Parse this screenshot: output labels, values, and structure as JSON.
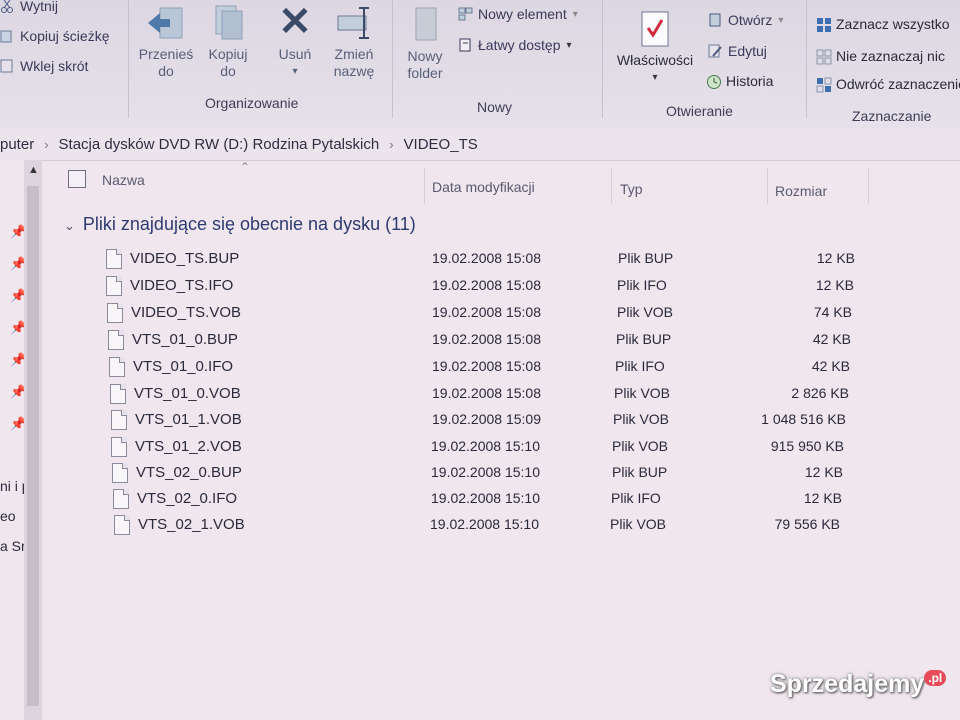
{
  "ribbon": {
    "clipboard": {
      "cut_label": "Wytnij",
      "copy_path_label": "Kopiuj ścieżkę",
      "paste_shortcut_label": "Wklej skrót"
    },
    "organize": {
      "move_label": "Przenieś",
      "move_sub": "do",
      "copy_label": "Kopiuj",
      "copy_sub": "do",
      "delete_label": "Usuń",
      "rename_label": "Zmień",
      "rename_sub": "nazwę",
      "group_label": "Organizowanie"
    },
    "new": {
      "new_folder_label": "Nowy",
      "new_folder_sub": "folder",
      "new_item_label": "Nowy element",
      "easy_access_label": "Łatwy dostęp",
      "group_label": "Nowy"
    },
    "open": {
      "properties_label": "Właściwości",
      "open_label": "Otwórz",
      "edit_label": "Edytuj",
      "history_label": "Historia",
      "group_label": "Otwieranie"
    },
    "select": {
      "select_all_label": "Zaznacz wszystko",
      "select_none_label": "Nie zaznaczaj nic",
      "invert_label": "Odwróć zaznaczenie",
      "group_label": "Zaznaczanie"
    }
  },
  "address": {
    "crumbs": [
      "puter",
      "Stacja dysków DVD RW (D:) Rodzina Pytalskich",
      "VIDEO_TS"
    ]
  },
  "nav": {
    "items": [
      "ni i pie",
      "eo",
      "a Smar"
    ]
  },
  "columns": {
    "name": "Nazwa",
    "date": "Data modyfikacji",
    "type": "Typ",
    "size": "Rozmiar"
  },
  "group": {
    "title": "Pliki znajdujące się obecnie na dysku (11)"
  },
  "files": [
    {
      "name": "VIDEO_TS.BUP",
      "date": "19.02.2008 15:08",
      "type": "Plik BUP",
      "size": "12 KB"
    },
    {
      "name": "VIDEO_TS.IFO",
      "date": "19.02.2008 15:08",
      "type": "Plik IFO",
      "size": "12 KB"
    },
    {
      "name": "VIDEO_TS.VOB",
      "date": "19.02.2008 15:08",
      "type": "Plik VOB",
      "size": "74 KB"
    },
    {
      "name": "VTS_01_0.BUP",
      "date": "19.02.2008 15:08",
      "type": "Plik BUP",
      "size": "42 KB"
    },
    {
      "name": "VTS_01_0.IFO",
      "date": "19.02.2008 15:08",
      "type": "Plik IFO",
      "size": "42 KB"
    },
    {
      "name": "VTS_01_0.VOB",
      "date": "19.02.2008 15:08",
      "type": "Plik VOB",
      "size": "2 826 KB"
    },
    {
      "name": "VTS_01_1.VOB",
      "date": "19.02.2008 15:09",
      "type": "Plik VOB",
      "size": "1 048 516 KB"
    },
    {
      "name": "VTS_01_2.VOB",
      "date": "19.02.2008 15:10",
      "type": "Plik VOB",
      "size": "915 950 KB"
    },
    {
      "name": "VTS_02_0.BUP",
      "date": "19.02.2008 15:10",
      "type": "Plik BUP",
      "size": "12 KB"
    },
    {
      "name": "VTS_02_0.IFO",
      "date": "19.02.2008 15:10",
      "type": "Plik IFO",
      "size": "12 KB"
    },
    {
      "name": "VTS_02_1.VOB",
      "date": "19.02.2008 15:10",
      "type": "Plik VOB",
      "size": "79 556 KB"
    }
  ],
  "watermark": {
    "text": "Sprzedajemy",
    "suffix": ".pl"
  }
}
